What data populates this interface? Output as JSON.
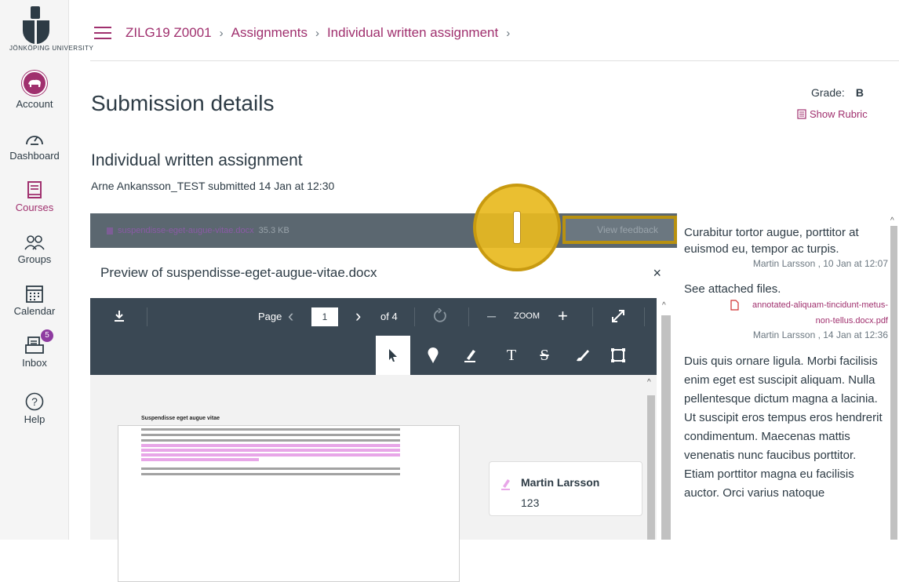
{
  "nav": {
    "logo_text": "JÖNKÖPING UNIVERSITY",
    "items": [
      {
        "label": "Account",
        "icon": "account-avatar"
      },
      {
        "label": "Dashboard",
        "icon": "dashboard-icon"
      },
      {
        "label": "Courses",
        "icon": "courses-icon"
      },
      {
        "label": "Groups",
        "icon": "groups-icon"
      },
      {
        "label": "Calendar",
        "icon": "calendar-icon"
      },
      {
        "label": "Inbox",
        "icon": "inbox-icon",
        "badge": "5"
      },
      {
        "label": "Help",
        "icon": "help-icon"
      }
    ]
  },
  "breadcrumb": {
    "course": "ZILG19 Z0001",
    "section": "Assignments",
    "item": "Individual written assignment",
    "sep": "›"
  },
  "header": {
    "title": "Submission details",
    "grade_label": "Grade:",
    "grade_value": "B",
    "rubric_link": "Show Rubric"
  },
  "assignment": {
    "title": "Individual written assignment",
    "submitted_line": "Arne Ankansson_TEST submitted 14 Jan at 12:30"
  },
  "viewer": {
    "file_name": "suspendisse-eget-augue-vitae.docx",
    "file_size": "35.3 KB",
    "view_feedback": "View feedback",
    "preview_title": "Preview of suspendisse-eget-augue-vitae.docx",
    "close": "×",
    "page_label": "Page",
    "page_value": "1",
    "page_of": "of 4",
    "zoom_label": "ZOOM",
    "doc_heading": "Suspendisse eget augue vitae",
    "comment_author": "Martin Larsson",
    "comment_text": "123"
  },
  "feedback": [
    {
      "text": "Curabitur tortor augue, porttitor at euismod eu, tempor ac turpis.",
      "meta": "Martin Larsson , 10 Jan at 12:07"
    },
    {
      "text": "See attached files.",
      "attachment": "annotated-aliquam-tincidunt-metus-non-tellus.docx.pdf",
      "meta": "Martin Larsson , 14 Jan at 12:36"
    },
    {
      "text": "Duis quis ornare ligula. Morbi facilisis enim eget est suscipit aliquam. Nulla pellentesque dictum magna a lacinia. Ut suscipit eros tempus eros hendrerit condimentum. Maecenas mattis venenatis nunc faucibus porttitor. Etiam porttitor magna eu facilisis auctor. Orci varius natoque"
    }
  ],
  "colors": {
    "accent": "#a0306e",
    "toolbar": "#3a4854",
    "hotspot": "#e8ba20"
  }
}
